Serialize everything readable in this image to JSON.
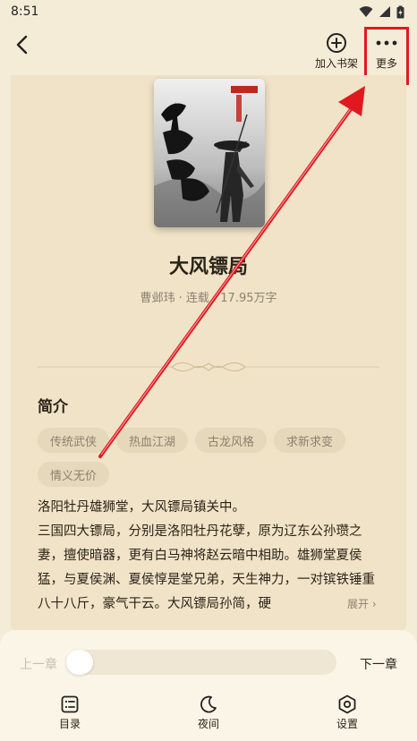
{
  "status_bar": {
    "time": "8:51"
  },
  "top_bar": {
    "add_to_shelf_label": "加入书架",
    "more_label": "更多"
  },
  "book": {
    "cover_title_text": "大风镖局",
    "title": "大风镖局",
    "meta": "曹邺玮 · 连载 · 17.95万字"
  },
  "intro": {
    "heading": "简介",
    "tags": [
      "传统武侠",
      "热血江湖",
      "古龙风格",
      "求新求变",
      "情义无价"
    ],
    "synopsis": [
      "洛阳牡丹雄狮堂，大风镖局镇关中。",
      "三国四大镖局，分别是洛阳牡丹花孽，原为辽东公孙瓒之妻，擅使暗器，更有白马神将赵云暗中相助。雄狮堂夏侯猛，与夏侯渊、夏侯惇是堂兄弟，天生神力，一对镔铁锤重八十八斤，豪气干云。大风镖局孙简，硬"
    ],
    "expand_label": "展开"
  },
  "bottom_panel": {
    "prev_label": "上一章",
    "next_label": "下一章",
    "progress": 0.0,
    "nav": [
      {
        "label": "目录",
        "icon": "list-icon"
      },
      {
        "label": "夜间",
        "icon": "moon-icon"
      },
      {
        "label": "设置",
        "icon": "hexagon-gear-icon"
      }
    ]
  },
  "colors": {
    "background": "#f5ecd8",
    "card": "#f0e3c8",
    "highlight": "#e0191f",
    "muted": "#8c8170"
  }
}
